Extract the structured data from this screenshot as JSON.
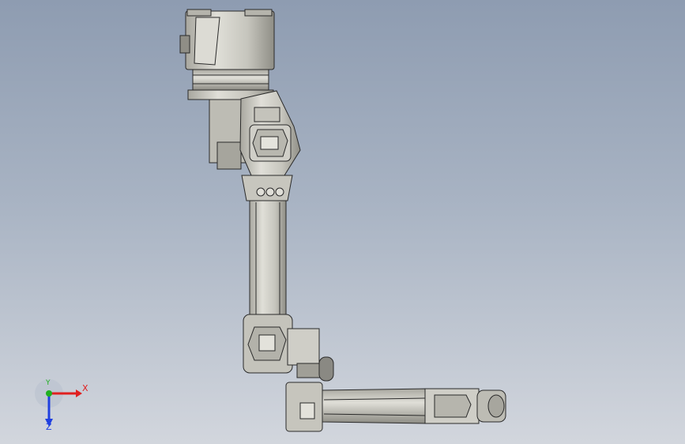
{
  "viewport": {
    "background_top": "#8e9cb1",
    "background_bottom": "#d2d6dd",
    "model": "robot-arm-6axis"
  },
  "triad": {
    "x_label": "X",
    "y_label": "Y",
    "z_label": "Z",
    "x_color": "#e02020",
    "y_color": "#20b020",
    "z_color": "#2040e0"
  },
  "palette": {
    "metal": "#c9c8c0",
    "metal_dark": "#9a9990",
    "metal_light": "#e2e1da",
    "edge": "#2a2a2a"
  }
}
